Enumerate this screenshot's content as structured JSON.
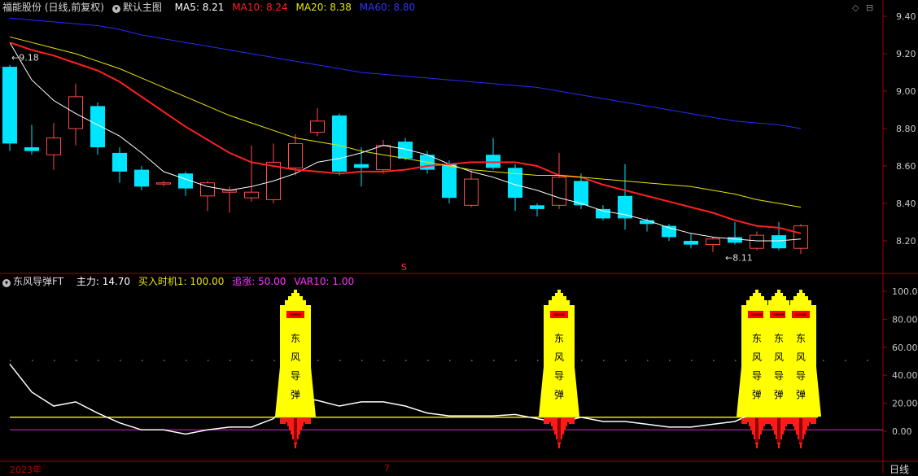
{
  "main_header": {
    "title": "福能股份 (日线,前复权)",
    "theme_label": "默认主图",
    "ma5": "MA5: 8.21",
    "ma10": "MA10: 8.24",
    "ma20": "MA20: 8.38",
    "ma60": "MA60: 8.80"
  },
  "sub_header": {
    "title": "东风导弹FT",
    "main_force": "主力: 14.70",
    "buy_timing": "买入时机1: 100.00",
    "chase": "追涨: 50.00",
    "var10": "VAR10: 1.00"
  },
  "footer": {
    "year": "2023年",
    "month": "7",
    "period": "日线"
  },
  "annotations": {
    "high_marker": "9.18",
    "low_marker": "8.11",
    "s_marker": "S"
  },
  "rocket_text": [
    "东",
    "风",
    "导",
    "弹"
  ],
  "colors": {
    "up": "#ff4b4b",
    "down": "#00e5ff",
    "ma5": "#ffffff",
    "ma10": "#ff2020",
    "ma20": "#e6e600",
    "ma60": "#2a2aff",
    "axis": "#a00000",
    "purple": "#cc33cc"
  },
  "chart_data": [
    {
      "type": "candlestick",
      "title": "福能股份 (日线,前复权)",
      "ylim": [
        8.05,
        9.47
      ],
      "yticks": [
        "9.40",
        "9.20",
        "9.00",
        "8.80",
        "8.60",
        "8.40",
        "8.20"
      ],
      "candles": [
        [
          9.13,
          8.72,
          9.14,
          8.68
        ],
        [
          8.7,
          8.68,
          8.82,
          8.66
        ],
        [
          8.66,
          8.75,
          8.83,
          8.58
        ],
        [
          8.8,
          8.97,
          9.04,
          8.71
        ],
        [
          8.92,
          8.7,
          8.94,
          8.66
        ],
        [
          8.67,
          8.57,
          8.7,
          8.51
        ],
        [
          8.58,
          8.49,
          8.6,
          8.47
        ],
        [
          8.51,
          8.51,
          8.52,
          8.49
        ],
        [
          8.56,
          8.48,
          8.57,
          8.44
        ],
        [
          8.44,
          8.51,
          8.52,
          8.36
        ],
        [
          8.46,
          8.47,
          8.49,
          8.35
        ],
        [
          8.43,
          8.46,
          8.71,
          8.41
        ],
        [
          8.42,
          8.62,
          8.72,
          8.4
        ],
        [
          8.59,
          8.72,
          8.77,
          8.55
        ],
        [
          8.78,
          8.84,
          8.91,
          8.76
        ],
        [
          8.87,
          8.57,
          8.88,
          8.55
        ],
        [
          8.61,
          8.59,
          8.7,
          8.49
        ],
        [
          8.58,
          8.71,
          8.74,
          8.56
        ],
        [
          8.73,
          8.64,
          8.75,
          8.63
        ],
        [
          8.66,
          8.58,
          8.68,
          8.56
        ],
        [
          8.61,
          8.43,
          8.63,
          8.4
        ],
        [
          8.39,
          8.53,
          8.58,
          8.38
        ],
        [
          8.66,
          8.59,
          8.75,
          8.58
        ],
        [
          8.59,
          8.43,
          8.61,
          8.36
        ],
        [
          8.39,
          8.37,
          8.4,
          8.33
        ],
        [
          8.39,
          8.54,
          8.67,
          8.37
        ],
        [
          8.52,
          8.39,
          8.56,
          8.37
        ],
        [
          8.37,
          8.32,
          8.39,
          8.31
        ],
        [
          8.44,
          8.32,
          8.61,
          8.26
        ],
        [
          8.31,
          8.29,
          8.32,
          8.25
        ],
        [
          8.28,
          8.22,
          8.29,
          8.2
        ],
        [
          8.2,
          8.18,
          8.24,
          8.16
        ],
        [
          8.18,
          8.21,
          8.22,
          8.14
        ],
        [
          8.22,
          8.19,
          8.3,
          8.18
        ],
        [
          8.16,
          8.23,
          8.25,
          8.15
        ],
        [
          8.23,
          8.16,
          8.3,
          8.15
        ],
        [
          8.16,
          8.28,
          8.29,
          8.13
        ]
      ],
      "series": [
        {
          "name": "MA5",
          "values": [
            9.26,
            9.06,
            8.95,
            8.88,
            8.82,
            8.76,
            8.67,
            8.57,
            8.53,
            8.49,
            8.47,
            8.49,
            8.52,
            8.56,
            8.62,
            8.64,
            8.67,
            8.71,
            8.69,
            8.66,
            8.61,
            8.57,
            8.54,
            8.5,
            8.47,
            8.43,
            8.4,
            8.36,
            8.34,
            8.31,
            8.27,
            8.24,
            8.22,
            8.21,
            8.2,
            8.2,
            8.21
          ]
        },
        {
          "name": "MA10",
          "values": [
            9.26,
            9.22,
            9.19,
            9.15,
            9.11,
            9.05,
            8.97,
            8.89,
            8.81,
            8.74,
            8.67,
            8.62,
            8.6,
            8.58,
            8.57,
            8.56,
            8.57,
            8.57,
            8.58,
            8.6,
            8.61,
            8.62,
            8.62,
            8.62,
            8.6,
            8.55,
            8.54,
            8.5,
            8.47,
            8.44,
            8.41,
            8.38,
            8.35,
            8.31,
            8.28,
            8.27,
            8.24
          ]
        },
        {
          "name": "MA20",
          "values": [
            9.29,
            9.26,
            9.23,
            9.2,
            9.16,
            9.12,
            9.07,
            9.02,
            8.97,
            8.92,
            8.87,
            8.83,
            8.79,
            8.75,
            8.73,
            8.71,
            8.68,
            8.66,
            8.64,
            8.62,
            8.6,
            8.58,
            8.57,
            8.56,
            8.55,
            8.55,
            8.54,
            8.53,
            8.52,
            8.51,
            8.5,
            8.49,
            8.47,
            8.45,
            8.42,
            8.4,
            8.38
          ]
        },
        {
          "name": "MA60",
          "values": [
            9.39,
            9.38,
            9.37,
            9.36,
            9.35,
            9.33,
            9.3,
            9.28,
            9.26,
            9.24,
            9.22,
            9.2,
            9.18,
            9.16,
            9.14,
            9.12,
            9.1,
            9.09,
            9.08,
            9.07,
            9.06,
            9.05,
            9.04,
            9.03,
            9.02,
            9.0,
            8.98,
            8.96,
            8.94,
            8.92,
            8.9,
            8.88,
            8.86,
            8.84,
            8.83,
            8.82,
            8.8
          ]
        }
      ]
    },
    {
      "type": "line",
      "title": "东风导弹FT",
      "ylim": [
        -17,
        108
      ],
      "yticks": [
        "100.00",
        "80.00",
        "60.00",
        "40.00",
        "20.00",
        "0.00"
      ],
      "series": [
        {
          "name": "主力",
          "values": [
            48,
            28,
            18,
            21,
            13,
            6,
            1,
            1,
            -2,
            1,
            3,
            3,
            9,
            25,
            22,
            18,
            21,
            21,
            18,
            13,
            11,
            11,
            11,
            12,
            9,
            6,
            10,
            7,
            7,
            5,
            3,
            3,
            5,
            7,
            14,
            14,
            14.7
          ]
        },
        {
          "name": "买入时机1",
          "values": [
            10,
            10,
            10,
            10,
            10,
            10,
            10,
            10,
            10,
            10,
            10,
            10,
            10,
            100,
            10,
            10,
            10,
            10,
            10,
            10,
            10,
            10,
            10,
            10,
            10,
            100,
            10,
            10,
            10,
            10,
            10,
            10,
            10,
            10,
            100,
            100,
            100
          ]
        },
        {
          "name": "VAR10",
          "values": [
            1,
            1,
            1,
            1,
            1,
            1,
            1,
            1,
            1,
            1,
            1,
            1,
            1,
            1,
            1,
            1,
            1,
            1,
            1,
            1,
            1,
            1,
            1,
            1,
            1,
            1,
            1,
            1,
            1,
            1,
            1,
            1,
            1,
            1,
            1,
            1,
            1
          ]
        }
      ]
    }
  ]
}
